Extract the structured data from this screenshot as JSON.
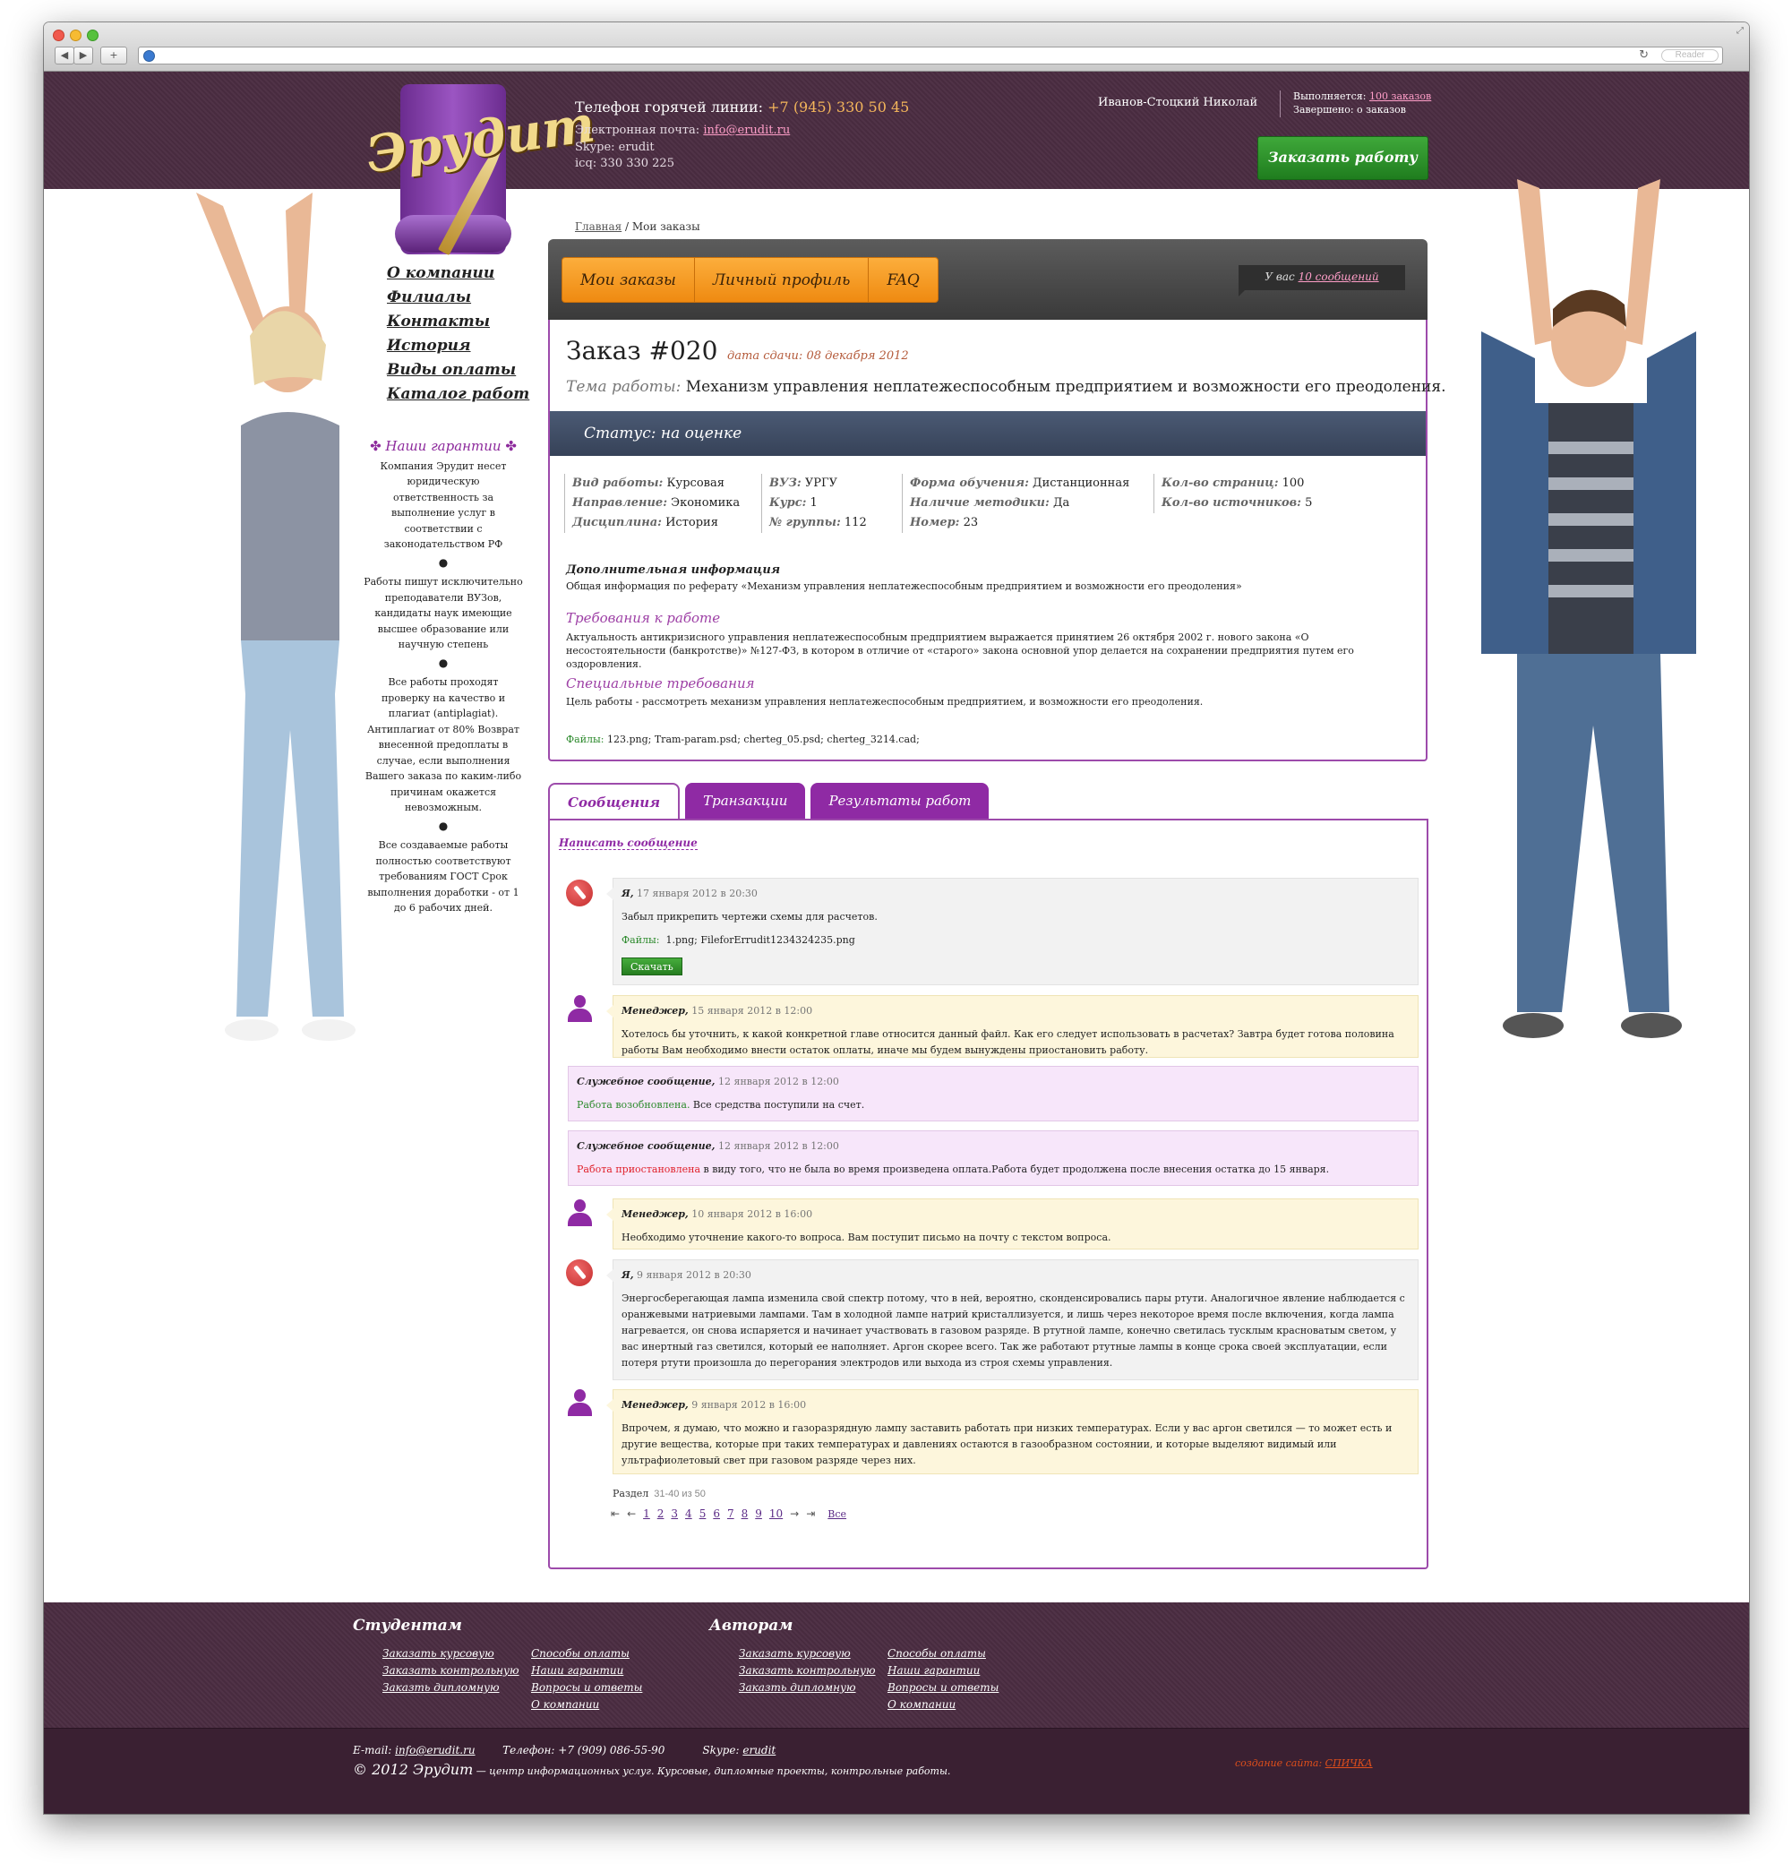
{
  "browser": {
    "reader_label": "Reader",
    "back_glyph": "◀",
    "forward_glyph": "▶",
    "add_glyph": "+",
    "reload_glyph": "↻",
    "resize_glyph": "⤢"
  },
  "header": {
    "logo_text": "Эрудит",
    "hotline_label": "Телефон горячей линии:",
    "hotline_phone": "+7 (945) 330 50 45",
    "email_label": "Электронная почта:",
    "email": "info@erudit.ru",
    "skype": "Skype: erudit",
    "icq": "icq: 330 330 225",
    "user_name": "Иванов-Стоцкий Николай",
    "in_work_label": "Выполняется:",
    "in_work_link": "100 заказов",
    "done": "Завершено: о заказов",
    "order_button": "Заказать работу"
  },
  "left_nav": [
    "О компании",
    "Филиалы",
    "Контакты",
    "История",
    "Виды оплаты",
    "Каталог работ"
  ],
  "guarantees": {
    "title": "Наши гарантии",
    "ornament": "✤",
    "bullet": "●",
    "items": [
      "Компания Эрудит несет юридическую ответственность за выполнение услуг в соответствии с законодательством РФ",
      "Работы пишут исключительно преподаватели ВУЗов, кандидаты наук имеющие высшее образование или научную степень",
      "Все работы проходят проверку на качество и плагиат (antiplagiat). Антиплагиат от 80% Возврат внесенной предоплаты в случае, если выполнения Вашего заказа по каким-либо причинам окажется невозможным.",
      "Все создаваемые работы полностью соответствуют требованиям ГОСТ Срок выполнения доработки - от 1 до 6 рабочих дней."
    ]
  },
  "breadcrumb": {
    "home": "Главная",
    "sep": " / ",
    "current": "Мои заказы"
  },
  "main_tabs": [
    "Мои заказы",
    "Личный профиль",
    "FAQ"
  ],
  "messages_notice": {
    "prefix": "У вас",
    "link": "10 сообщений"
  },
  "order": {
    "title": "Заказ #020",
    "date": "дата сдачи: 08 декабря 2012",
    "topic_label": "Тема работы:",
    "topic": "Механизм управления неплатежеспособным предприятием и возможности его преодоления.",
    "status": "Статус: на оценке",
    "fields": [
      [
        {
          "k": "Вид работы:",
          "v": "Курсовая"
        },
        {
          "k": "Направление:",
          "v": "Экономика"
        },
        {
          "k": "Дисциплина:",
          "v": "История"
        }
      ],
      [
        {
          "k": "ВУЗ:",
          "v": "УРГУ"
        },
        {
          "k": "Курс:",
          "v": "1"
        },
        {
          "k": "№ группы:",
          "v": "112"
        }
      ],
      [
        {
          "k": "Форма обучения:",
          "v": "Дистанционная"
        },
        {
          "k": "Наличие методики:",
          "v": "Да"
        },
        {
          "k": "Номер:",
          "v": "23"
        }
      ],
      [
        {
          "k": "Кол-во страниц:",
          "v": "100"
        },
        {
          "k": "Кол-во источников:",
          "v": "5"
        }
      ]
    ],
    "add_info_title": "Дополнительная информация",
    "add_info_text": "Общая информация по реферату «Механизм управления неплатежеспособным предприятием и возможности его преодоления»",
    "req_title": "Требования к работе",
    "req_text": "Актуальность антикризисного управления неплатежеспособным предприятием выражается принятием 26 октября 2002 г. нового закона «О несостоятельности (банкротстве)» №127-ФЗ, в котором в отличие от «старого» закона основной упор делается на сохранении предприятия путем его оздоровления.",
    "spec_title": "Специальные требования",
    "spec_text": "Цель работы - рассмотреть механизм управления неплатежеспособным предприятием, и возможности его преодоления.",
    "files_label": "Файлы:",
    "files": "123.png; Tram-param.psd; cherteg_05.psd; cherteg_3214.cad;"
  },
  "lower_tabs": [
    "Сообщения",
    "Транзакции",
    "Результаты работ"
  ],
  "write_message": "Написать сообщение",
  "messages": [
    {
      "type": "me",
      "who": "Я,",
      "when": "17 января 2012 в 20:30",
      "text": "Забыл прикрепить чертежи схемы для расчетов.",
      "files_label": "Файлы:",
      "files": "1.png;  FileforErrudit1234324235.png",
      "button": "Скачать"
    },
    {
      "type": "mgr",
      "who": "Менеджер,",
      "when": "15 января 2012 в 12:00",
      "text": "Хотелось бы уточнить, к какой конкретной главе относится данный файл. Как его следует использовать в расчетах? Завтра будет готова половина работы Вам необходимо внести остаток оплаты, иначе мы будем вынуждены приостановить работу."
    },
    {
      "type": "svc",
      "who": "Служебное сообщение,",
      "when": "12 января 2012 в 12:00",
      "status": "Работа возобновлена.",
      "status_color": "#2d8a2d",
      "text": " Все средства поступили на счет."
    },
    {
      "type": "svc",
      "who": "Служебное сообщение,",
      "when": "12 января 2012 в 12:00",
      "status": "Работа приостановлена",
      "status_color": "#e0202a",
      "text": " в виду того, что не была во время произведена оплата.Работа будет продолжена после внесения остатка до 15 января."
    },
    {
      "type": "mgr",
      "who": "Менеджер,",
      "when": "10 января 2012 в 16:00",
      "text": "Необходимо уточнение какого-то вопроса. Вам поступит письмо на почту с текстом вопроса."
    },
    {
      "type": "me",
      "who": "Я,",
      "when": "9 января 2012 в 20:30",
      "text": "Энергосберегающая лампа изменила свой спектр потому, что в ней, вероятно, сконденсировались пары ртути. Аналогичное явление наблюдается с оранжевыми натриевыми лампами. Там в холодной лампе натрий кристаллизуется, и лишь через некоторое время после включения, когда лампа нагревается, он снова испаряется и начинает участвовать в газовом разряде. В ртутной лампе, конечно светилась тусклым красноватым светом, у вас инертный газ светился, который ее наполняет. Аргон скорее всего. Так же работают ртутные лампы в конце срока своей эксплуатации, если потеря ртути произошла до перегорания электродов или выхода из строя схемы управления."
    },
    {
      "type": "mgr",
      "who": "Менеджер,",
      "when": "9 января 2012 в 16:00",
      "text": "Впрочем, я думаю, что можно и газоразрядную лампу заставить работать при низких температурах. Если у вас аргон светился — то может есть и другие вещества, которые при таких температурах и давлениях остаются в газообразном состоянии, и которые выделяют видимый или ультрафиолетовый свет при газовом разряде через них."
    }
  ],
  "pager": {
    "label": "Раздел",
    "count": "31-40 из 50",
    "first": "⇤",
    "prev": "←",
    "pages": [
      "1",
      "2",
      "3",
      "4",
      "5",
      "6",
      "7",
      "8",
      "9",
      "10"
    ],
    "next": "→",
    "last": "⇥",
    "all": "Все"
  },
  "footer": {
    "students_title": "Студентам",
    "authors_title": "Авторам",
    "students_col1": [
      "Заказать курсовую",
      "Заказать контрольную",
      "Заказть дипломную"
    ],
    "students_col2": [
      "Способы оплаты",
      "Наши гарантии",
      "Вопросы и ответы",
      "О компании"
    ],
    "authors_col1": [
      "Заказать курсовую",
      "Заказать контрольную",
      "Заказть дипломную"
    ],
    "authors_col2": [
      "Способы оплаты",
      "Наши гарантии",
      "Вопросы и ответы",
      "О компании"
    ],
    "email_label": "E-mail:",
    "email": "info@erudit.ru",
    "phone": "Телефон: +7 (909) 086-55-90",
    "skype_label": "Skype:",
    "skype": "erudit",
    "copy_sign": "© 2012 Эрудит",
    "copy_text": " — центр информационных услуг. Курсовые, дипломные проекты, контрольные работы.",
    "maker_label": "создание сайта:",
    "maker_link": "СПИЧКА"
  }
}
